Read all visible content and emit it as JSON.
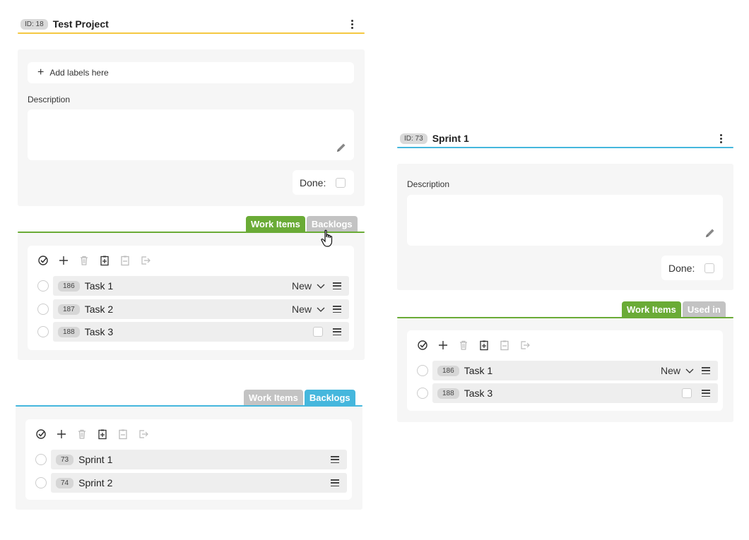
{
  "project": {
    "id_label": "ID: 18",
    "title": "Test Project",
    "add_labels": "Add labels here",
    "description_label": "Description",
    "done_label": "Done:",
    "tabs": [
      "Work Items",
      "Backlogs"
    ],
    "work_items": [
      {
        "id": "186",
        "title": "Task 1",
        "status": "New"
      },
      {
        "id": "187",
        "title": "Task 2",
        "status": "New"
      },
      {
        "id": "188",
        "title": "Task 3",
        "status": ""
      }
    ]
  },
  "backlogs_panel": {
    "tabs": [
      "Work Items",
      "Backlogs"
    ],
    "items": [
      {
        "id": "73",
        "title": "Sprint 1"
      },
      {
        "id": "74",
        "title": "Sprint 2"
      }
    ]
  },
  "sprint": {
    "id_label": "ID: 73",
    "title": "Sprint 1",
    "description_label": "Description",
    "done_label": "Done:",
    "tabs": [
      "Work Items",
      "Used in"
    ],
    "work_items": [
      {
        "id": "186",
        "title": "Task 1",
        "status": "New"
      },
      {
        "id": "188",
        "title": "Task 3",
        "status": ""
      }
    ]
  },
  "colors": {
    "project_accent": "#f5c842",
    "sprint_accent": "#45b7dd",
    "green_tab": "#6aab36",
    "blue_tab": "#45b7dd",
    "inactive_tab": "#c3c3c3"
  }
}
